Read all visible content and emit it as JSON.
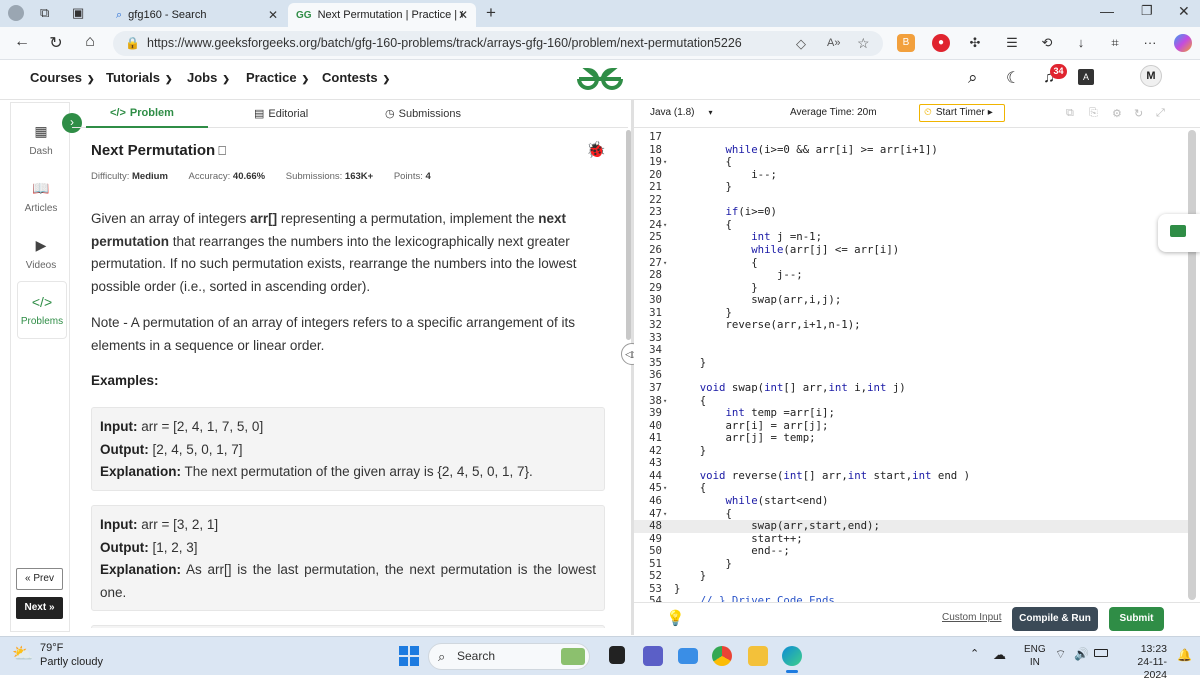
{
  "browser": {
    "tabs": [
      {
        "title": "gfg160 - Search",
        "active": false
      },
      {
        "title": "Next Permutation | Practice | Gee",
        "active": true
      }
    ],
    "url": "https://www.geeksforgeeks.org/batch/gfg-160-problems/track/arrays-gfg-160/problem/next-permutation5226"
  },
  "site_header": {
    "menus": [
      "Courses",
      "Tutorials",
      "Jobs",
      "Practice",
      "Contests"
    ],
    "notification_count": "34",
    "avatar_initial": "M"
  },
  "sidebar": {
    "items": [
      {
        "label": "Dash",
        "icon": "dashboard-icon"
      },
      {
        "label": "Articles",
        "icon": "book-icon"
      },
      {
        "label": "Videos",
        "icon": "video-icon"
      },
      {
        "label": "Problems",
        "icon": "code-icon"
      }
    ],
    "prev_label": "« Prev",
    "next_label": "Next »"
  },
  "problem_tabs": [
    "Problem",
    "Editorial",
    "Submissions"
  ],
  "problem": {
    "title": "Next Permutation",
    "difficulty_label": "Difficulty:",
    "difficulty": "Medium",
    "accuracy_label": "Accuracy:",
    "accuracy": "40.66%",
    "submissions_label": "Submissions:",
    "submissions": "163K+",
    "points_label": "Points:",
    "points": "4",
    "desc_1": "Given an array of integers ",
    "desc_arr": "arr[]",
    "desc_2": " representing a permutation, implement the ",
    "desc_bold": "next permutation",
    "desc_3": " that rearranges the numbers into the lexicographically next greater permutation. If no such permutation exists, rearrange the numbers into the lowest possible order (i.e., sorted in ascending order).",
    "note": "Note - A permutation of an array of integers refers to a specific arrangement of its elements in a sequence or linear order.",
    "examples_heading": "Examples:",
    "examples": [
      {
        "input": "arr = [2, 4, 1, 7, 5, 0]",
        "output": "[2, 4, 5, 0, 1, 7]",
        "explanation": "The next permutation of the given array is {2, 4, 5, 0, 1, 7}."
      },
      {
        "input": "arr = [3, 2, 1]",
        "output": "[1, 2, 3]",
        "explanation": "As arr[] is the last permutation, the next permutation is the lowest one."
      }
    ],
    "input_label": "Input:",
    "output_label": "Output:",
    "explanation_label": "Explanation:"
  },
  "editor": {
    "language": "Java (1.8)",
    "avg_time": "Average Time: 20m",
    "timer_label": "Start Timer",
    "highlighted_line": "48",
    "lines": [
      {
        "n": "17",
        "f": "",
        "t": ""
      },
      {
        "n": "18",
        "f": "",
        "t": "        while(i>=0 && arr[i] >= arr[i+1])"
      },
      {
        "n": "19",
        "f": "▾",
        "t": "        {"
      },
      {
        "n": "20",
        "f": "",
        "t": "            i--;"
      },
      {
        "n": "21",
        "f": "",
        "t": "        }"
      },
      {
        "n": "22",
        "f": "",
        "t": ""
      },
      {
        "n": "23",
        "f": "",
        "t": "        if(i>=0)"
      },
      {
        "n": "24",
        "f": "▾",
        "t": "        {"
      },
      {
        "n": "25",
        "f": "",
        "t": "            int j =n-1;"
      },
      {
        "n": "26",
        "f": "",
        "t": "            while(arr[j] <= arr[i])"
      },
      {
        "n": "27",
        "f": "▾",
        "t": "            {"
      },
      {
        "n": "28",
        "f": "",
        "t": "                j--;"
      },
      {
        "n": "29",
        "f": "",
        "t": "            }"
      },
      {
        "n": "30",
        "f": "",
        "t": "            swap(arr,i,j);"
      },
      {
        "n": "31",
        "f": "",
        "t": "        }"
      },
      {
        "n": "32",
        "f": "",
        "t": "        reverse(arr,i+1,n-1);"
      },
      {
        "n": "33",
        "f": "",
        "t": ""
      },
      {
        "n": "34",
        "f": "",
        "t": ""
      },
      {
        "n": "35",
        "f": "",
        "t": "    }"
      },
      {
        "n": "36",
        "f": "",
        "t": ""
      },
      {
        "n": "37",
        "f": "",
        "t": "    void swap(int[] arr,int i,int j)"
      },
      {
        "n": "38",
        "f": "▾",
        "t": "    {"
      },
      {
        "n": "39",
        "f": "",
        "t": "        int temp =arr[i];"
      },
      {
        "n": "40",
        "f": "",
        "t": "        arr[i] = arr[j];"
      },
      {
        "n": "41",
        "f": "",
        "t": "        arr[j] = temp;"
      },
      {
        "n": "42",
        "f": "",
        "t": "    }"
      },
      {
        "n": "43",
        "f": "",
        "t": ""
      },
      {
        "n": "44",
        "f": "",
        "t": "    void reverse(int[] arr,int start,int end )"
      },
      {
        "n": "45",
        "f": "▾",
        "t": "    {"
      },
      {
        "n": "46",
        "f": "",
        "t": "        while(start<end)"
      },
      {
        "n": "47",
        "f": "▾",
        "t": "        {"
      },
      {
        "n": "48",
        "f": "",
        "t": "            swap(arr,start,end);"
      },
      {
        "n": "49",
        "f": "",
        "t": "            start++;"
      },
      {
        "n": "50",
        "f": "",
        "t": "            end--;"
      },
      {
        "n": "51",
        "f": "",
        "t": "        }"
      },
      {
        "n": "52",
        "f": "",
        "t": "    }"
      },
      {
        "n": "53",
        "f": "",
        "t": "}"
      },
      {
        "n": "54",
        "f": "",
        "t": "    // } Driver Code Ends"
      }
    ],
    "custom_input": "Custom Input",
    "compile_label": "Compile & Run",
    "submit_label": "Submit"
  },
  "taskbar": {
    "temp": "79°F",
    "weather": "Partly cloudy",
    "search_placeholder": "Search",
    "lang_top": "ENG",
    "lang_bottom": "IN",
    "time": "13:23",
    "date": "24-11-2024"
  },
  "colors": {
    "brand_green": "#2f8d46",
    "dark_button": "#3b4a57",
    "notification_red": "#e0242f",
    "timer_border": "#f0b400"
  }
}
